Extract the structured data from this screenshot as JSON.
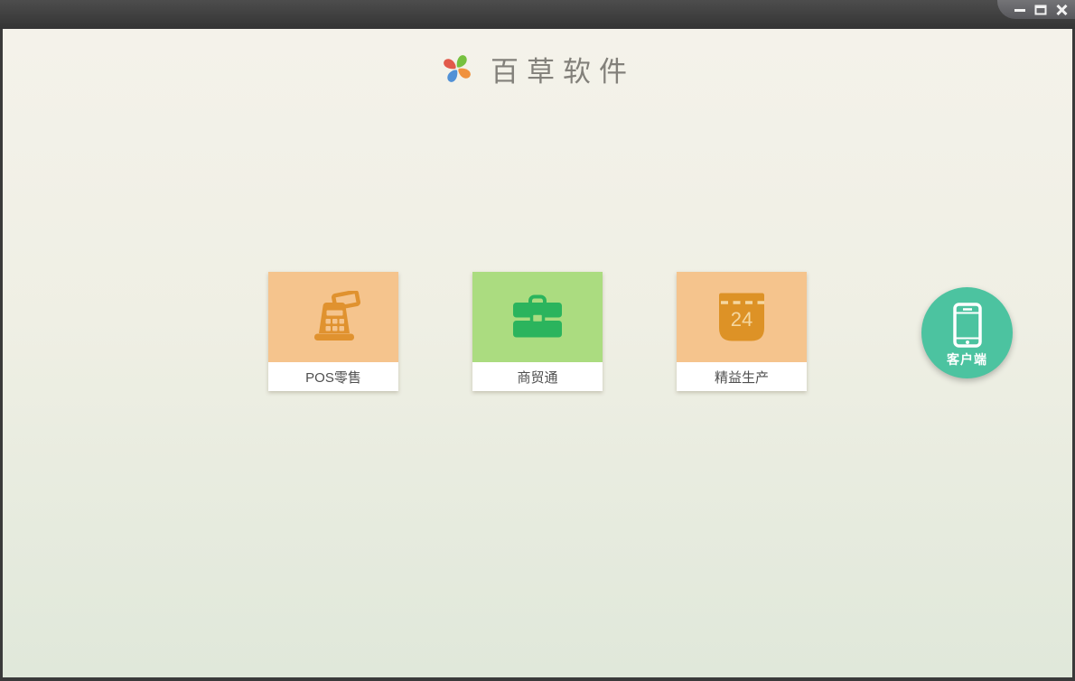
{
  "window": {
    "controls": {
      "minimize": "minimize",
      "maximize": "maximize",
      "close": "close"
    },
    "titlebar_color": "#3f3f3f",
    "frame_color": "#3a3a3a"
  },
  "header": {
    "title": "百草软件",
    "logo": "pinwheel-logo",
    "logo_colors": {
      "green": "#76c13f",
      "orange": "#f0923e",
      "blue": "#5191d6",
      "red": "#e25a4b"
    }
  },
  "products": [
    {
      "label": "POS零售",
      "icon": "cash-register-icon",
      "bg": "#f5c48d",
      "icon_color": "#e0922f"
    },
    {
      "label": "商贸通",
      "icon": "briefcase-icon",
      "bg": "#abdc80",
      "icon_color": "#2bb45d"
    },
    {
      "label": "精益生产",
      "icon": "calendar-icon",
      "bg": "#f5c48d",
      "icon_color": "#dd9226",
      "badge": "24",
      "detail_color": "#f5d7a0"
    }
  ],
  "client_button": {
    "label": "客户端",
    "bg": "#4cc3a0",
    "icon": "smartphone-icon",
    "icon_color": "#ffffff"
  },
  "background": {
    "top": "#f4f2ea",
    "bottom": "#e0e8da"
  }
}
